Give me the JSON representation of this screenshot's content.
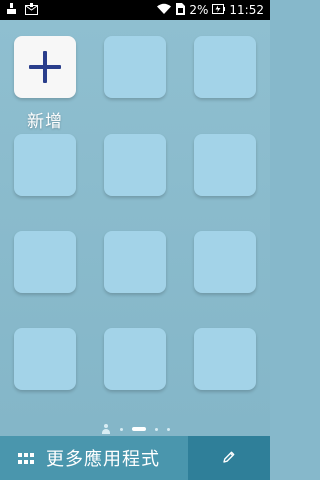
{
  "status_bar": {
    "battery_percent": "2%",
    "time": "11:52",
    "icons": [
      "notification-icon",
      "mail-icon",
      "wifi-icon",
      "sim-icon",
      "battery-charging-icon"
    ]
  },
  "home": {
    "add_label": "新增",
    "page_indicator": {
      "pages": 4,
      "active_index": 1
    }
  },
  "bottom_bar": {
    "more_apps_label": "更多應用程式",
    "icons": [
      "apps-grid-icon",
      "pencil-icon"
    ]
  },
  "colors": {
    "background": "#86b8cb",
    "tile": "#a3d3e8",
    "add_tile": "#f7f7f7",
    "plus": "#2a3e8c",
    "bottom_left": "#4a96ad",
    "bottom_right": "#2f7f99"
  }
}
